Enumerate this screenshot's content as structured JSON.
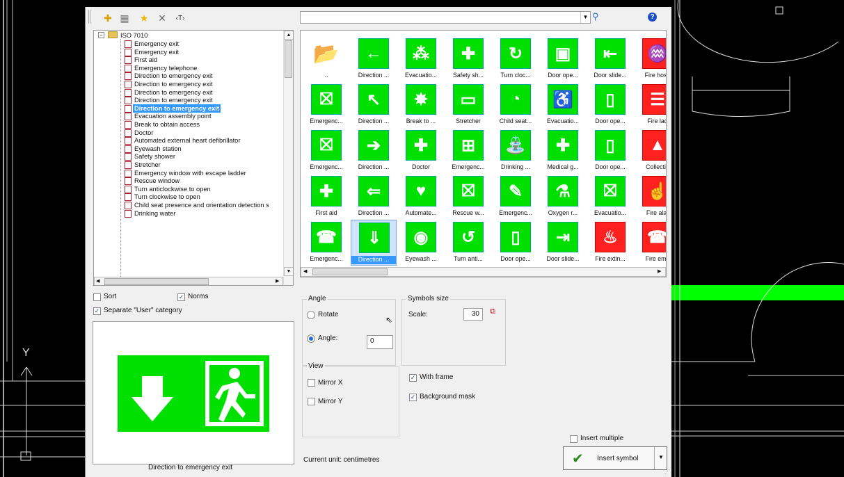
{
  "toolbar": {
    "icons": [
      "add-icon",
      "grid-icon",
      "star-icon",
      "delete-icon",
      "text-tool-icon"
    ],
    "search_value": "",
    "search_icon": "magnifier-icon",
    "help_icon": "help-icon"
  },
  "tree": {
    "root": "ISO 7010",
    "items": [
      "Emergency exit",
      "Emergency exit",
      "First aid",
      "Emergency telephone",
      "Direction to emergency exit",
      "Direction to emergency exit",
      "Direction to emergency exit",
      "Direction to emergency exit",
      "Direction to emergency exit",
      "Evacuation assembly point",
      "Break to obtain access",
      "Doctor",
      "Automated external heart defibrillator",
      "Eyewash station",
      "Safety shower",
      "Stretcher",
      "Emergency window with escape ladder",
      "Rescue window",
      "Turn anticlockwise to open",
      "Turn clockwise to open",
      "Child seat presence and orientation detection s",
      "Drinking water"
    ],
    "selected_index": 8
  },
  "grid": {
    "rows": [
      [
        {
          "label": "..",
          "icon": "folder",
          "color": "none",
          "glyph": "📂"
        },
        {
          "label": "Direction ...",
          "color": "green",
          "glyph": "←"
        },
        {
          "label": "Evacuatio...",
          "color": "green",
          "glyph": "⁂"
        },
        {
          "label": "Safety sh...",
          "color": "green",
          "glyph": "✚"
        },
        {
          "label": "Turn cloc...",
          "color": "green",
          "glyph": "↻"
        },
        {
          "label": "Door ope...",
          "color": "green",
          "glyph": "▣"
        },
        {
          "label": "Door slide...",
          "color": "green",
          "glyph": "⇤"
        },
        {
          "label": "Fire hose",
          "color": "red",
          "glyph": "♒"
        }
      ],
      [
        {
          "label": "Emergenc...",
          "color": "green",
          "glyph": "⛝"
        },
        {
          "label": "Direction ...",
          "color": "green",
          "glyph": "↖"
        },
        {
          "label": "Break to ...",
          "color": "green",
          "glyph": "✸"
        },
        {
          "label": "Stretcher",
          "color": "green",
          "glyph": "▭"
        },
        {
          "label": "Child seat...",
          "color": "green",
          "glyph": "◔"
        },
        {
          "label": "Evacuatio...",
          "color": "green",
          "glyph": "♿"
        },
        {
          "label": "Door ope...",
          "color": "green",
          "glyph": "▯"
        },
        {
          "label": "Fire lad",
          "color": "red",
          "glyph": "☰"
        }
      ],
      [
        {
          "label": "Emergenc...",
          "color": "green",
          "glyph": "⛝"
        },
        {
          "label": "Direction ...",
          "color": "green",
          "glyph": "➔"
        },
        {
          "label": "Doctor",
          "color": "green",
          "glyph": "✚"
        },
        {
          "label": "Emergenc...",
          "color": "green",
          "glyph": "⊞"
        },
        {
          "label": "Drinking ...",
          "color": "green",
          "glyph": "⛲"
        },
        {
          "label": "Medical g...",
          "color": "green",
          "glyph": "✚"
        },
        {
          "label": "Door ope...",
          "color": "green",
          "glyph": "▯"
        },
        {
          "label": "Collectio",
          "color": "red",
          "glyph": "▲"
        }
      ],
      [
        {
          "label": "First aid",
          "color": "green",
          "glyph": "✚"
        },
        {
          "label": "Direction ...",
          "color": "green",
          "glyph": "⇐"
        },
        {
          "label": "Automate...",
          "color": "green",
          "glyph": "♥"
        },
        {
          "label": "Rescue w...",
          "color": "green",
          "glyph": "⛝"
        },
        {
          "label": "Emergenc...",
          "color": "green",
          "glyph": "✎"
        },
        {
          "label": "Oxygen r...",
          "color": "green",
          "glyph": "⚗"
        },
        {
          "label": "Evacuatio...",
          "color": "green",
          "glyph": "⛝"
        },
        {
          "label": "Fire alar",
          "color": "red",
          "glyph": "☝"
        }
      ],
      [
        {
          "label": "Emergenc...",
          "color": "green",
          "glyph": "☎"
        },
        {
          "label": "Direction ...",
          "color": "green",
          "glyph": "⇓"
        },
        {
          "label": "Eyewash ...",
          "color": "green",
          "glyph": "◉"
        },
        {
          "label": "Turn anti...",
          "color": "green",
          "glyph": "↺"
        },
        {
          "label": "Door ope...",
          "color": "green",
          "glyph": "▯"
        },
        {
          "label": "Door slide...",
          "color": "green",
          "glyph": "⇥"
        },
        {
          "label": "Fire extin...",
          "color": "red",
          "glyph": "♨"
        },
        {
          "label": "Fire eme",
          "color": "red",
          "glyph": "☎"
        }
      ]
    ],
    "selected": [
      4,
      1
    ]
  },
  "options": {
    "sort_label": "Sort",
    "sort_checked": false,
    "norms_label": "Norms",
    "norms_checked": true,
    "separate_label": "Separate \"User\" category",
    "separate_checked": true
  },
  "angle": {
    "group_label": "Angle",
    "rotate_label": "Rotate",
    "angle_label": "Angle:",
    "angle_value": "0",
    "mode": "angle"
  },
  "size": {
    "group_label": "Symbols size",
    "scale_label": "Scale:",
    "scale_value": "30"
  },
  "view": {
    "group_label": "View",
    "mirror_x": "Mirror X",
    "mirror_y": "Mirror Y"
  },
  "frame": {
    "with_frame": "With frame",
    "with_frame_checked": true,
    "background_mask": "Background mask",
    "background_mask_checked": true
  },
  "preview_caption": "Direction to emergency exit",
  "current_unit": "Current unit: centimetres",
  "insert_multiple": "Insert multiple",
  "insert_symbol": "Insert symbol",
  "colors": {
    "sign_green": "#00e000",
    "sign_red": "#ff2020",
    "selection": "#3399ff",
    "cad_green": "#00ff00"
  }
}
